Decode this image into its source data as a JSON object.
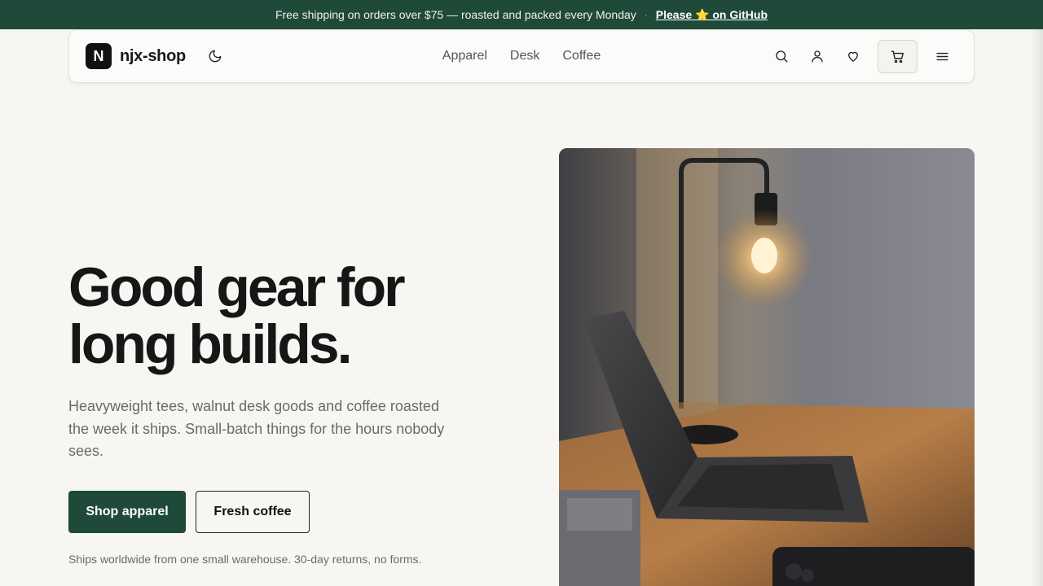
{
  "announcement": {
    "text": "Free shipping on orders over $75 — roasted and packed every Monday",
    "separator": "·",
    "link_label": "Please ⭐ on GitHub"
  },
  "brand": {
    "logo_letter": "N",
    "name": "njx-shop"
  },
  "nav": {
    "links": [
      "Apparel",
      "Desk",
      "Coffee"
    ]
  },
  "actions": {
    "icons": [
      "moon-icon",
      "search-icon",
      "user-icon",
      "heart-icon",
      "cart-icon",
      "menu-icon"
    ]
  },
  "hero": {
    "title_line1": "Good gear for",
    "title_line2": "long builds.",
    "subtitle": "Heavyweight tees, walnut desk goods and coffee roasted the week it ships. Small-batch things for the hours nobody sees.",
    "primary_cta": "Shop apparel",
    "secondary_cta": "Fresh coffee",
    "note": "Ships worldwide from one small warehouse. 30-day returns, no forms."
  },
  "colors": {
    "accent": "#1f4a3a",
    "background": "#f7f6f2",
    "text": "#161616",
    "muted": "#6a6a66"
  }
}
